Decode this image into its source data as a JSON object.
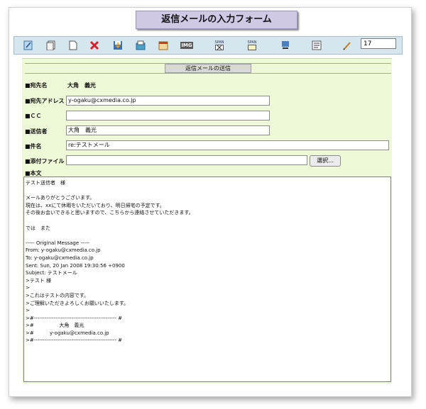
{
  "page": {
    "title": "返信メールの入力フォーム"
  },
  "toolbar": {
    "icons": [
      "edit-note-icon",
      "copy-icon",
      "document-icon",
      "delete-icon",
      "save-icon",
      "folder-icon",
      "calendar-icon",
      "img-icon",
      "span-x-icon",
      "span-icon",
      "attachment-icon",
      "text-icon",
      "pen-icon"
    ],
    "icon_labels": {
      "img": "IMG",
      "span": "SPAN"
    },
    "zoom_value": "17"
  },
  "section": {
    "title": "返信メールの送信"
  },
  "form": {
    "to_name_label": "■宛先名",
    "to_name_value": "大角　義光",
    "to_address_label": "■宛先アドレス",
    "to_address_value": "y-ogaku@cxmedia.co.jp",
    "cc_label": "■ＣＣ",
    "cc_value": "",
    "sender_label": "■送信者",
    "sender_value": "大角　義光",
    "subject_label": "■件名",
    "subject_value": "re:テストメール",
    "attachment_label": "■添付ファイル",
    "attachment_value": "",
    "browse_button": "選択...",
    "body_label": "■本文"
  },
  "body_text": "テスト送信者　様\n\nメールありがとうございます。\n現在は、xxにて休暇をいただいており、明日帰宅の予定です。\nその後お会いできると思いますので、こちらから連絡させていただきます。\n\nでは　また\n\n----- Original Message -----\nFrom: y-ogaku@cxmedia.co.jp\nTo: y-ogaku@cxmedia.co.jp\nSent: Sun, 20 Jan 2008 19:30:56 +0900\nSubject: テストメール\n>テスト 様\n>\n>これはテストの内容です。\n>ご理解いただきよろしくお願いいたします。\n>\n>#---------------------------------------------- #\n>#                大角　義光\n>#          y-ogaku@cxmedia.co.jp\n>#---------------------------------------------- #"
}
